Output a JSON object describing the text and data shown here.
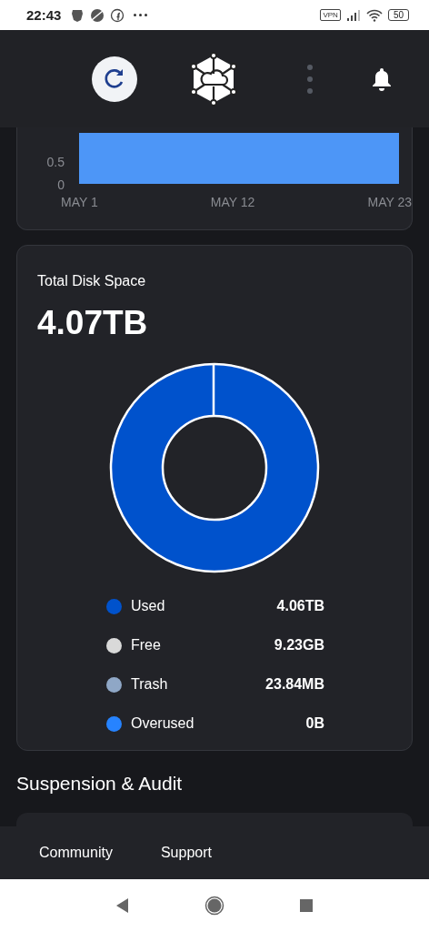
{
  "status_bar": {
    "time": "22:43",
    "vpn": "VPN",
    "battery": "50"
  },
  "bandwidth_chart": {
    "y_ticks": [
      "0.5",
      "0"
    ],
    "x_labels": [
      "MAY 1",
      "MAY 12",
      "MAY 23"
    ]
  },
  "disk_card": {
    "title": "Total Disk Space",
    "total": "4.07TB",
    "legend": [
      {
        "label": "Used",
        "value": "4.06TB",
        "color": "#0052cc"
      },
      {
        "label": "Free",
        "value": "9.23GB",
        "color": "#d9d9d9"
      },
      {
        "label": "Trash",
        "value": "23.84MB",
        "color": "#8fa7c6"
      },
      {
        "label": "Overused",
        "value": "0B",
        "color": "#2683ff"
      }
    ]
  },
  "section_title": "Suspension & Audit",
  "footer_nav": [
    "Community",
    "Support"
  ]
}
